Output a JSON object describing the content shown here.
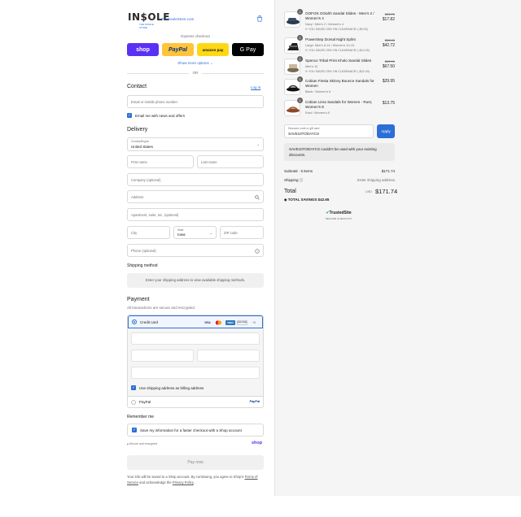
{
  "header": {
    "logo_text": "IN$OLE",
    "logo_sub": "THE INSOLE STORE",
    "site_url": "TheInsoleStore.com"
  },
  "express": {
    "label": "Express checkout",
    "buttons": [
      "shop",
      "PayPal",
      "amazon pay",
      "G Pay"
    ],
    "more_options": "Show more options ⌄",
    "or": "OR"
  },
  "contact": {
    "title": "Contact",
    "login": "Log in",
    "email_placeholder": "Email or mobile phone number",
    "newsletter_label": "Email me with news and offers"
  },
  "delivery": {
    "title": "Delivery",
    "country_label": "Country/Region",
    "country_value": "United States",
    "first_name": "First name",
    "last_name": "Last name",
    "company": "Company (optional)",
    "address": "Address",
    "apartment": "Apartment, suite, etc. (optional)",
    "city": "City",
    "state_label": "State",
    "state_value": "Iowa",
    "zip": "ZIP code",
    "phone": "Phone (optional)"
  },
  "shipping_method": {
    "title": "Shipping method",
    "message": "Enter your shipping address to view available shipping methods."
  },
  "payment": {
    "title": "Payment",
    "subtitle": "All transactions are secure and encrypted.",
    "credit_card_label": "Credit card",
    "card_logos": [
      "VISA",
      "MC",
      "AMEX",
      "DISCOVER",
      "+5"
    ],
    "billing_same_label": "Use shipping address as billing address",
    "paypal_label": "PayPal",
    "paypal_logo": "PayPal"
  },
  "remember": {
    "title": "Remember me",
    "save_label": "Save my information for a faster checkout with a Shop account",
    "secure_text": "Secure and encrypted",
    "shop_mark": "shop"
  },
  "pay_now": "Pay now",
  "legal": {
    "text": "Your info will be saved to a Shop account. By continuing, you agree to Shop's",
    "terms": "Terms of Service",
    "middle": "and acknowledge the",
    "privacy": "Privacy Policy",
    "end": "."
  },
  "order": {
    "items": [
      {
        "qty": "1",
        "name": "OOFOS OOahh Sandal Slides - Men's 2 / Women's 4",
        "variant": "Navy / Men's 2 / Women's 4",
        "saved": "YOU SAVED 25% ON CLEARANCE! (-$5.93)",
        "old_price": "$23.70",
        "price": "$17.82"
      },
      {
        "qty": "1",
        "name": "PowerStep Dorsal Night Splint",
        "variant": "Large: Men's 8-14 / Women's 10-15",
        "saved": "YOU SAVED 25% ON CLEARANCE! (-$14.25)",
        "old_price": "$56.95",
        "price": "$42.72"
      },
      {
        "qty": "1",
        "name": "Spenco Tribal Print Kholo Sandal Slides",
        "variant": "Men's 10",
        "saved": "YOU SAVED 25% ON CLEARANCE! (-$22.49)",
        "old_price": "$89.99",
        "price": "$67.50"
      },
      {
        "qty": "1",
        "name": "Cobian Fiesta Skinny Bounce Sandals for Women",
        "variant": "Black / Women's 6",
        "saved": "",
        "old_price": "",
        "price": "$29.95"
      },
      {
        "qty": "1",
        "name": "Cobian Lima Sandals for Women - Rust, Women's 8",
        "variant": "Rust / Women's 8",
        "saved": "",
        "old_price": "",
        "price": "$13.75"
      }
    ],
    "discount_label": "Discount code or gift card",
    "discount_value": "SAVE10TODAYCS",
    "apply": "Apply",
    "error": "SAVE10TODAYCS couldn't be used with your existing discounts.",
    "subtotal_label": "Subtotal · 5 items",
    "subtotal_value": "$171.74",
    "shipping_label": "Shipping ⓘ",
    "shipping_value": "Enter shipping address",
    "total_label": "Total",
    "currency": "USD",
    "total_value": "$171.74",
    "savings": "TOTAL SAVINGS  $42.65",
    "trusted_main": "TrustedSite",
    "trusted_sub": "SECURE CHECKOUT"
  },
  "colors": {
    "accent": "#2b6fd6",
    "shop": "#5a31f4",
    "paypal": "#ffc439",
    "amazon": "#ffd814",
    "gpay": "#000000",
    "summary_bg": "#f5f5f5"
  }
}
